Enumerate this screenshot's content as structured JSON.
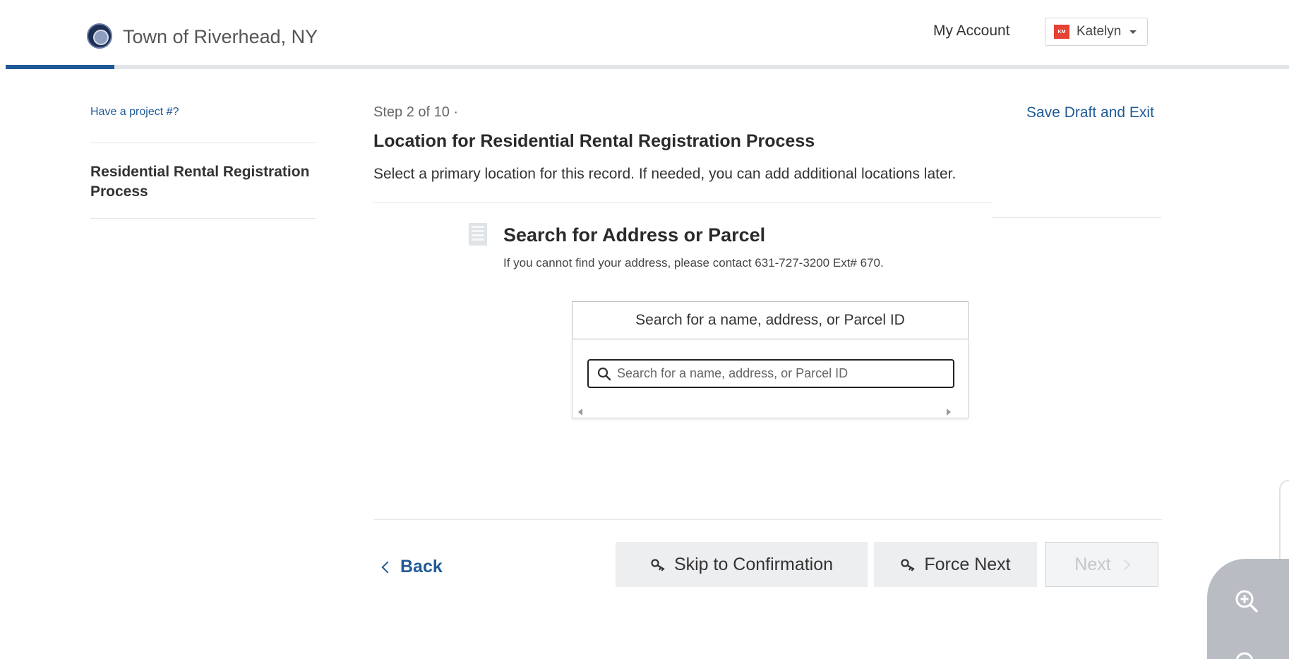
{
  "header": {
    "town_name": "Town of Riverhead, NY",
    "my_account": "My Account",
    "user_initials": "KM",
    "user_name": "Katelyn"
  },
  "sidebar": {
    "have_project": "Have a project #?",
    "process_title": "Residential Rental Registration Process"
  },
  "main": {
    "step": "Step 2 of 10 ·",
    "save_draft": "Save Draft and Exit",
    "title": "Location for Residential Rental Registration Process",
    "instruction": "Select a primary location for this record. If needed, you can add additional locations later.",
    "search_heading": "Search for Address or Parcel",
    "contact_note": "If you cannot find your address, please contact 631-727-3200 Ext# 670.",
    "search_trigger_label": "Search for a name, address, or Parcel ID",
    "search_placeholder": "Search for a name, address, or Parcel ID",
    "search_value": ""
  },
  "footer": {
    "back": "Back",
    "skip": "Skip to Confirmation",
    "force_next": "Force Next",
    "next": "Next"
  },
  "colors": {
    "accent": "#1f5a96",
    "avatar": "#e64133"
  },
  "icons": [
    "building-icon",
    "search-icon",
    "key-icon",
    "zoom-in-icon",
    "zoom-out-icon",
    "chevron-left-icon",
    "chevron-right-icon",
    "caret-down-icon"
  ]
}
